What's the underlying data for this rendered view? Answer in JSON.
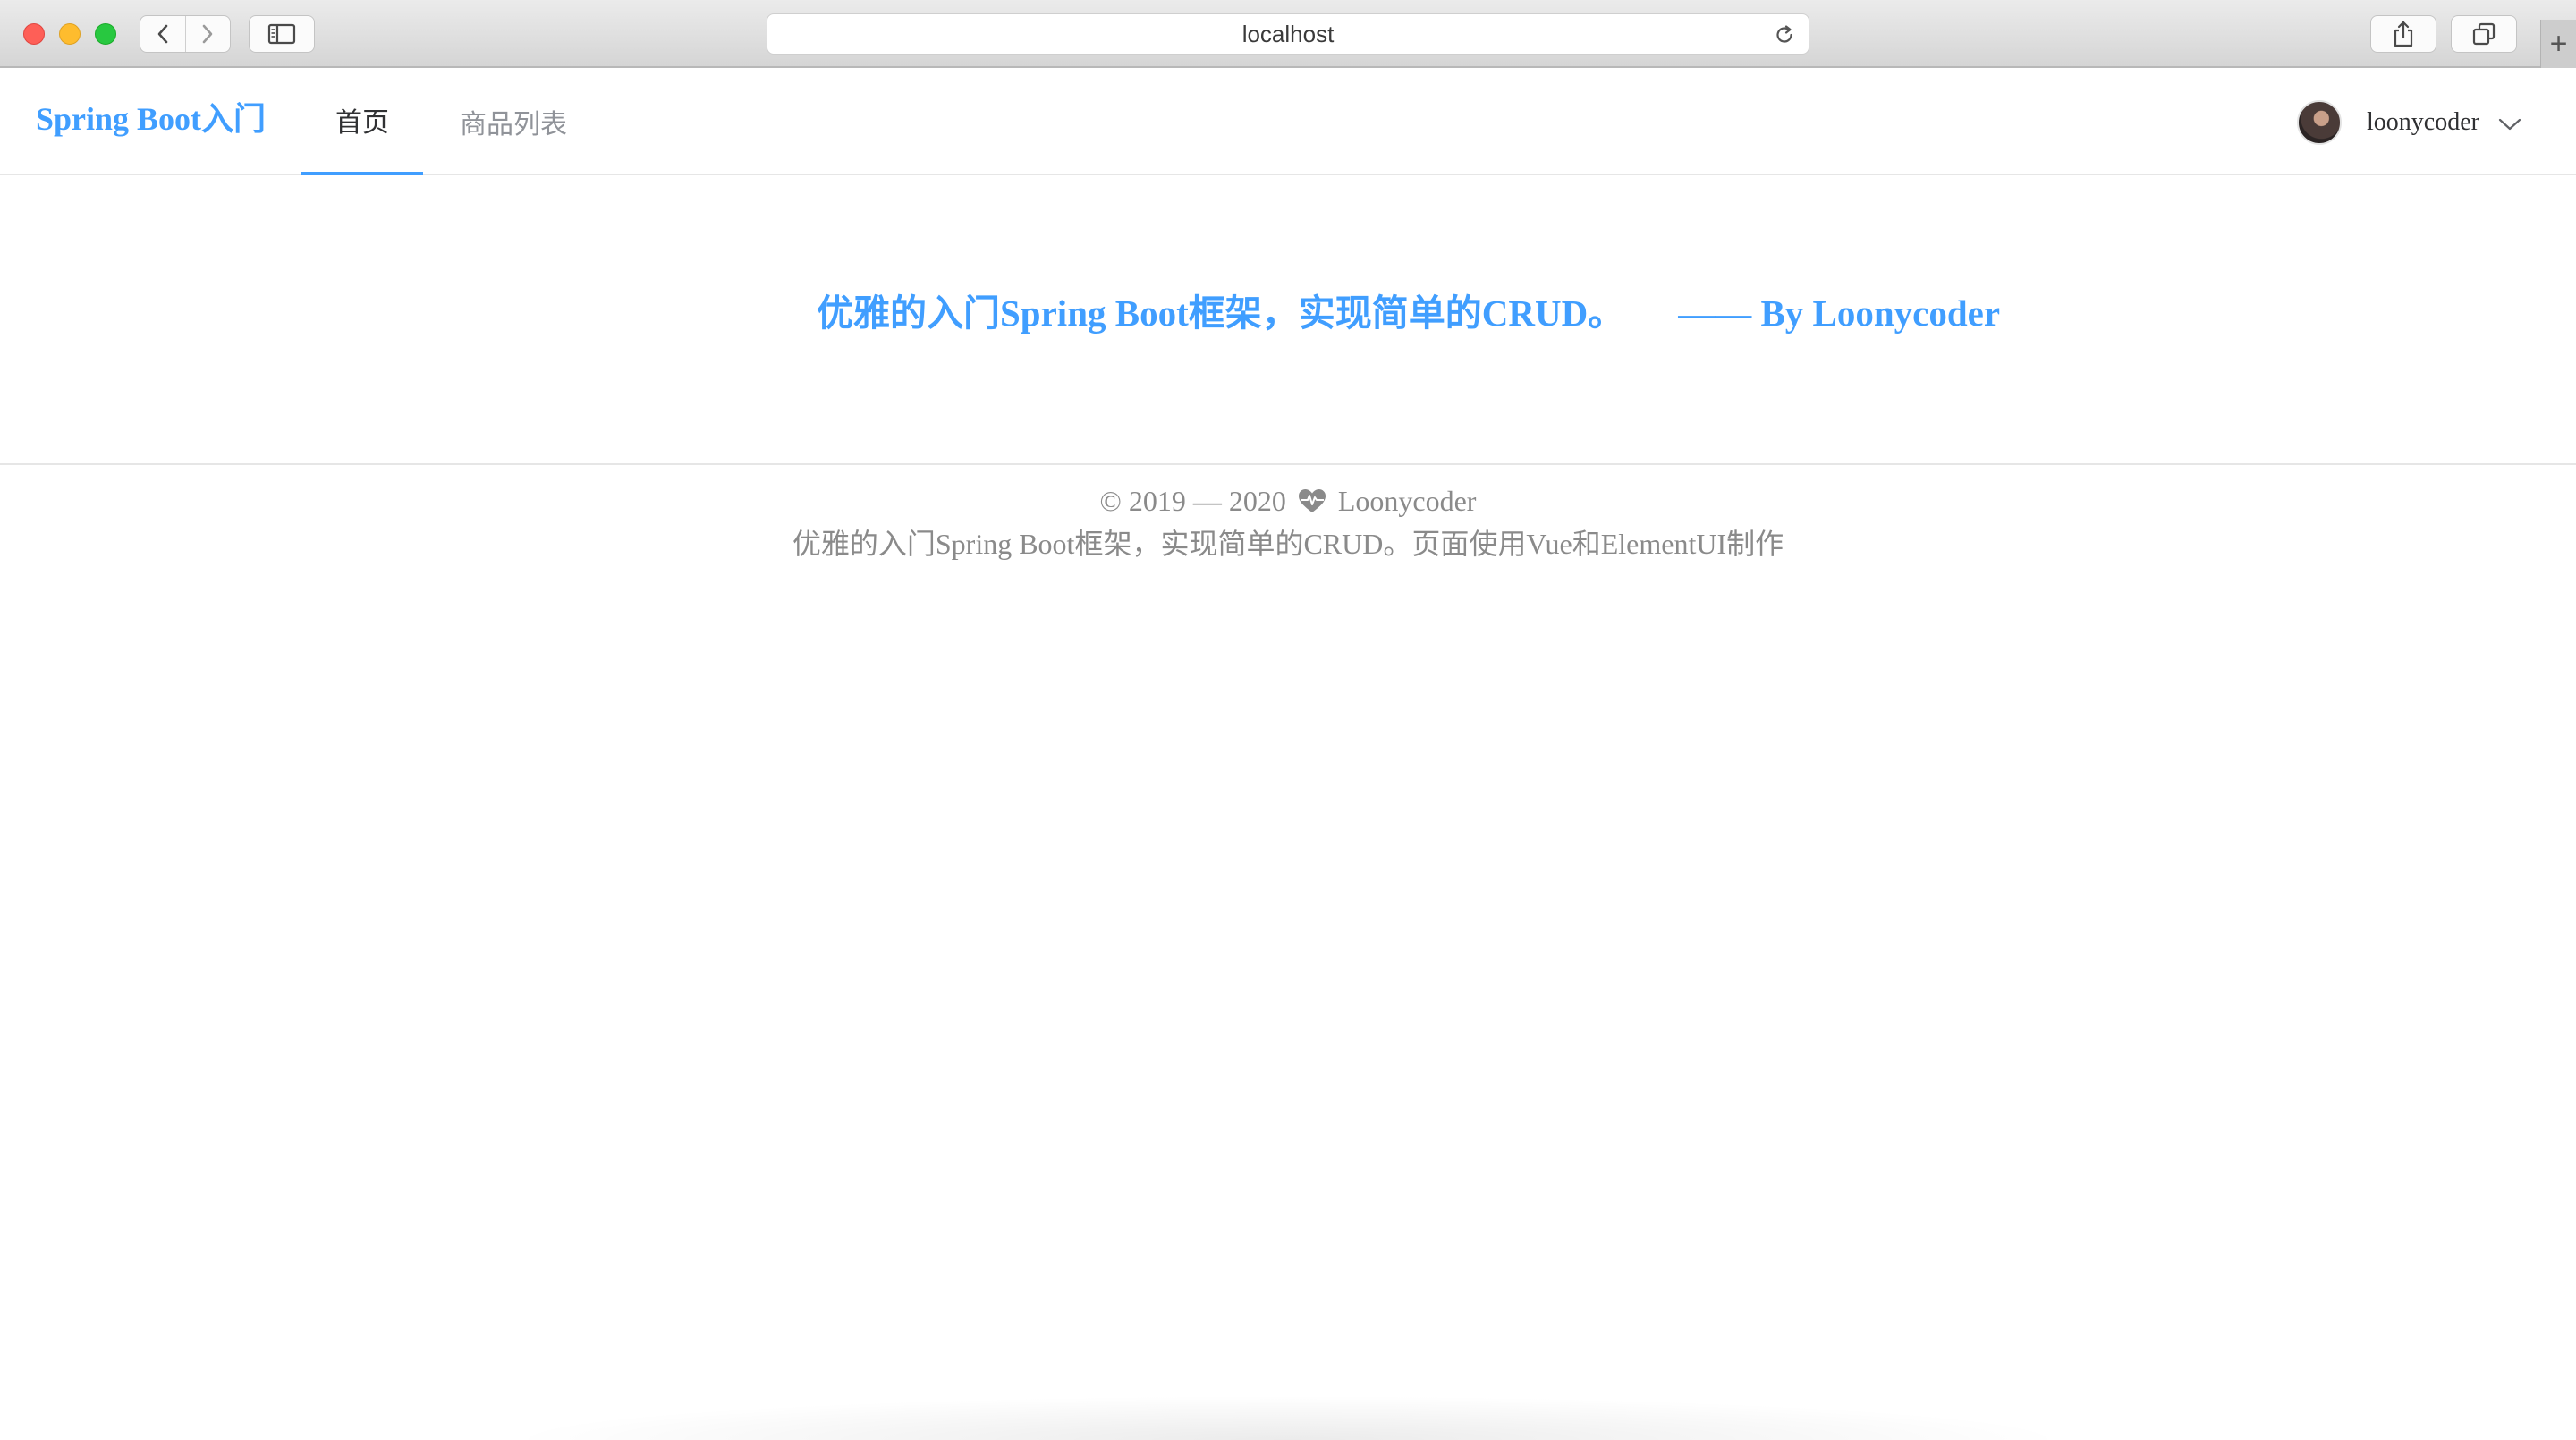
{
  "browser": {
    "address": "localhost",
    "icons": {
      "back": "chevron-left-icon",
      "forward": "chevron-right-icon",
      "sidebar": "sidebar-icon",
      "reload": "reload-icon",
      "share": "share-icon",
      "tabs": "tabs-overview-icon",
      "new_tab": "+"
    }
  },
  "header": {
    "brand": "Spring Boot入门",
    "menu": [
      {
        "label": "首页",
        "active": true
      },
      {
        "label": "商品列表",
        "active": false
      }
    ],
    "user": {
      "name": "loonycoder"
    }
  },
  "hero": {
    "slogan": "优雅的入门Spring Boot框架，实现简单的CRUD。",
    "byline": "—— By Loonycoder"
  },
  "footer": {
    "copyright_prefix": "© 2019 — 2020",
    "author": "Loonycoder",
    "description": "优雅的入门Spring Boot框架，实现简单的CRUD。页面使用Vue和ElementUI制作"
  },
  "colors": {
    "accent": "#409eff",
    "text_primary": "#303133",
    "text_secondary": "#909399",
    "footer_text": "#8a8a8a"
  }
}
